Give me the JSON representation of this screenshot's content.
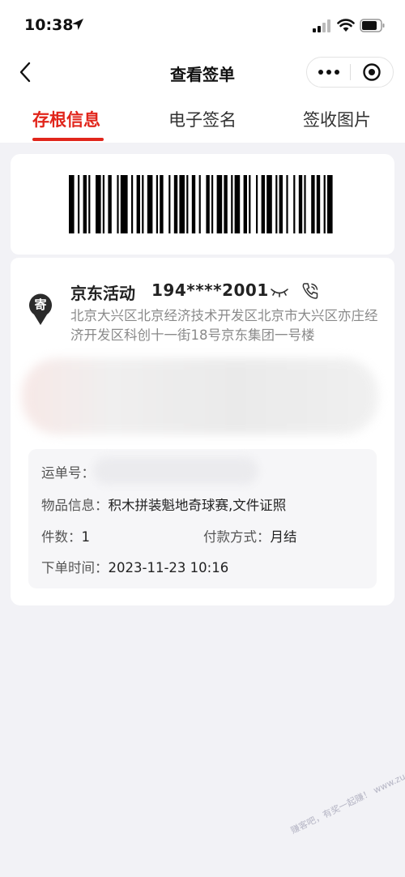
{
  "status_bar": {
    "time": "10:38"
  },
  "nav": {
    "title": "查看签单"
  },
  "tabs": [
    {
      "label": "存根信息",
      "active": true
    },
    {
      "label": "电子签名",
      "active": false
    },
    {
      "label": "签收图片",
      "active": false
    }
  ],
  "sender": {
    "badge": "寄",
    "name": "京东活动",
    "phone": "194****2001",
    "address": "北京大兴区北京经济技术开发区北京市大兴区亦庄经济开发区科创十一街18号京东集团一号楼"
  },
  "order_info": {
    "waybill_label": "运单号：",
    "waybill_value": "",
    "item_label": "物品信息：",
    "item_value": "积木拼装魁地奇球赛,文件证照",
    "count_label": "件数：",
    "count_value": "1",
    "payment_label": "付款方式：",
    "payment_value": "月结",
    "order_time_label": "下单时间：",
    "order_time_value": "2023-11-23 10:16"
  },
  "watermark": "赚客吧，有奖一起赚！ www.zuanke8.com",
  "colors": {
    "accent": "#e1251b",
    "background": "#f2f2f6",
    "card": "#ffffff"
  }
}
